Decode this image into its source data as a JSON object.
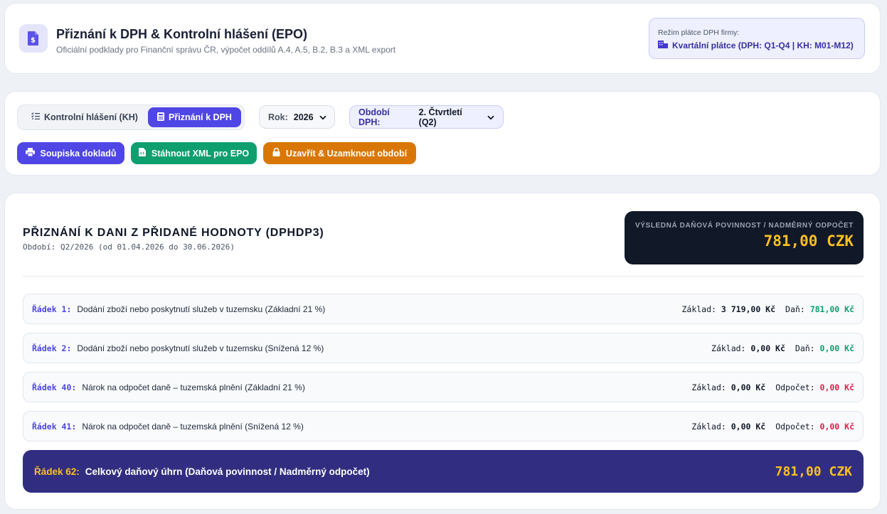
{
  "header": {
    "title": "Přiznání k DPH & Kontrolní hlášení (EPO)",
    "subtitle": "Oficiální podklady pro Finanční správu ČR, výpočet oddílů A.4, A.5, B.2, B.3 a XML export",
    "icon": "invoice-icon",
    "mode_label": "Režim plátce DPH firmy:",
    "mode_value": "Kvartální plátce (DPH: Q1-Q4 | KH: M01-M12)"
  },
  "controls": {
    "tab_kh": "Kontrolní hlášení (KH)",
    "tab_dph": "Přiznání k DPH",
    "year_label": "Rok:",
    "year_value": "2026",
    "period_label": "Období DPH:",
    "period_value": "2. Čtvrtletí (Q2)",
    "btn_list": "Soupiska dokladů",
    "btn_xml": "Stáhnout XML pro EPO",
    "btn_lock": "Uzavřít & Uzamknout období"
  },
  "report": {
    "title": "PŘIZNÁNÍ K DANI Z PŘIDANÉ HODNOTY (DPHDP3)",
    "period": "Období: Q2/2026 (od 01.04.2026 do 30.06.2026)",
    "result_label": "VÝSLEDNÁ DAŇOVÁ POVINNOST / NADMĚRNÝ ODPOČET",
    "result_value": "781,00 CZK",
    "rows": [
      {
        "no": "Řádek 1:",
        "desc": "Dodání zboží nebo poskytnutí služeb v tuzemsku (Základní 21 %)",
        "base_label": "Základ:",
        "base": "3 719,00 Kč",
        "tax_label": "Daň:",
        "tax": "781,00 Kč"
      },
      {
        "no": "Řádek 2:",
        "desc": "Dodání zboží nebo poskytnutí služeb v tuzemsku (Snížená 12 %)",
        "base_label": "Základ:",
        "base": "0,00 Kč",
        "tax_label": "Daň:",
        "tax": "0,00 Kč"
      },
      {
        "no": "Řádek 40:",
        "desc": "Nárok na odpočet daně – tuzemská plnění (Základní 21 %)",
        "base_label": "Základ:",
        "base": "0,00 Kč",
        "tax_label": "Odpočet:",
        "tax": "0,00 Kč"
      },
      {
        "no": "Řádek 41:",
        "desc": "Nárok na odpočet daně – tuzemská plnění (Snížená 12 %)",
        "base_label": "Základ:",
        "base": "0,00 Kč",
        "tax_label": "Odpočet:",
        "tax": "0,00 Kč"
      }
    ],
    "total_no": "Řádek 62:",
    "total_desc": "Celkový daňový úhrn (Daňová povinnost / Nadměrný odpočet)",
    "total_value": "781,00 CZK"
  },
  "colors": {
    "accent": "#4f46e5",
    "success": "#0e9f6e",
    "warning": "#d97706",
    "danger": "#e11d48",
    "total_bg": "#312e81",
    "result_bg": "#111827",
    "highlight": "#fbbf24"
  }
}
